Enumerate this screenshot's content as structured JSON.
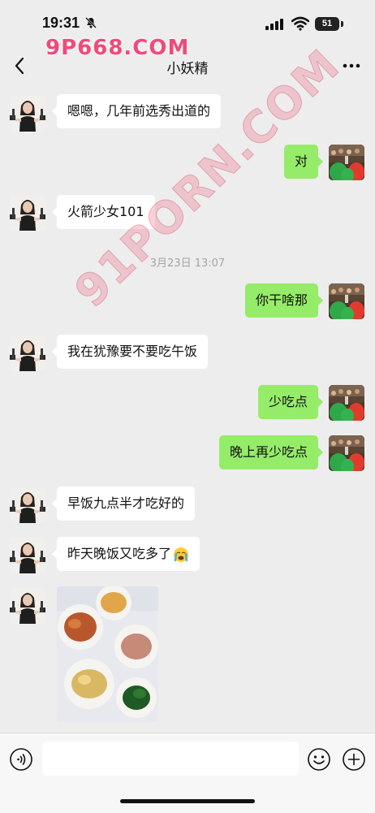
{
  "status_bar": {
    "time": "19:31",
    "battery": "51"
  },
  "watermarks": {
    "top": "9P668.COM",
    "diagonal": "91PORN.COM"
  },
  "nav": {
    "title": "小妖精"
  },
  "messages": [
    {
      "side": "left",
      "text": "嗯嗯，几年前选秀出道的"
    },
    {
      "side": "right",
      "text": "对"
    },
    {
      "side": "left",
      "text": "火箭少女101"
    },
    {
      "side": "right",
      "text": "你干啥那"
    },
    {
      "side": "left",
      "text": "我在犹豫要不要吃午饭"
    },
    {
      "side": "right",
      "text": "少吃点"
    },
    {
      "side": "right",
      "text": "晚上再少吃点"
    },
    {
      "side": "left",
      "text": "早饭九点半才吃好的"
    },
    {
      "side": "left",
      "text": "昨天晚饭又吃多了",
      "emoji": "crying-face"
    },
    {
      "side": "left",
      "type": "image",
      "image": "food-photo"
    }
  ],
  "timestamp": "3月23日 13:07",
  "input": {
    "placeholder": ""
  },
  "icons": [
    "back-icon",
    "more-icon",
    "voice-icon",
    "emoji-icon",
    "plus-icon",
    "mute-icon",
    "signal-icon",
    "wifi-icon"
  ],
  "colors": {
    "bubble_right": "#95ec69",
    "bubble_left": "#ffffff",
    "background": "#ededed",
    "watermark": "#f04a7a"
  }
}
